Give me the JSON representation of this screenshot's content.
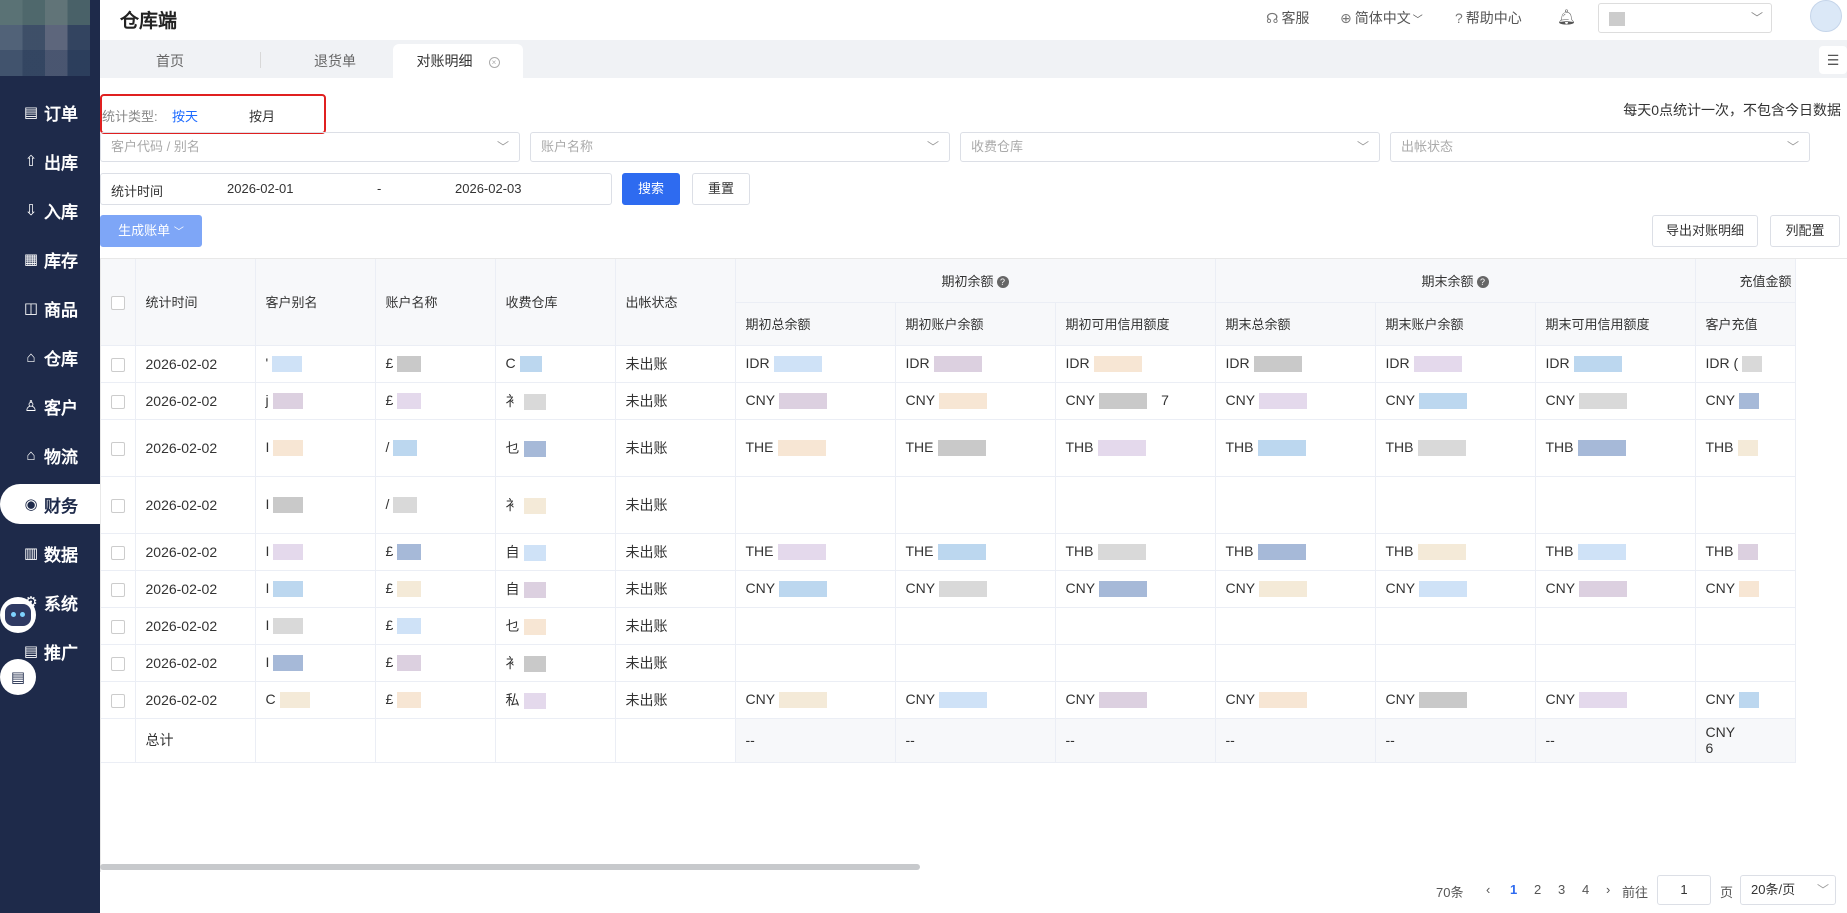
{
  "app_title": "仓库端",
  "header": {
    "service": "客服",
    "language": "简体中文",
    "help": "帮助中心"
  },
  "sidebar": {
    "items": [
      {
        "label": "订单",
        "icon": "order-icon",
        "glyph": "▤"
      },
      {
        "label": "出库",
        "icon": "outbound-icon",
        "glyph": "⇧"
      },
      {
        "label": "入库",
        "icon": "inbound-icon",
        "glyph": "⇩"
      },
      {
        "label": "库存",
        "icon": "inventory-icon",
        "glyph": "▦"
      },
      {
        "label": "商品",
        "icon": "goods-icon",
        "glyph": "◫"
      },
      {
        "label": "仓库",
        "icon": "warehouse-icon",
        "glyph": "⌂"
      },
      {
        "label": "客户",
        "icon": "customer-icon",
        "glyph": "♙"
      },
      {
        "label": "物流",
        "icon": "logistics-icon",
        "glyph": "⌂"
      },
      {
        "label": "财务",
        "icon": "finance-icon",
        "glyph": "◉"
      },
      {
        "label": "数据",
        "icon": "data-icon",
        "glyph": "▥"
      },
      {
        "label": "系统",
        "icon": "system-icon",
        "glyph": "⚙"
      },
      {
        "label": "推广",
        "icon": "promotion-icon",
        "glyph": "▤"
      }
    ],
    "active": "财务"
  },
  "tabs": [
    {
      "label": "首页"
    },
    {
      "label": "退货单"
    },
    {
      "label": "对账明细",
      "close": "⊗"
    }
  ],
  "filters": {
    "stat_type_label": "统计类型:",
    "stat_type_day": "按天",
    "stat_type_month": "按月",
    "notice": "每天0点统计一次，不包含今日数据",
    "customer_placeholder": "客户代码 / 别名",
    "account_placeholder": "账户名称",
    "warehouse_placeholder": "收费仓库",
    "status_placeholder": "出帐状态",
    "date_label": "统计时间",
    "date_start": "2026-02-01",
    "date_sep": "-",
    "date_end": "2026-02-03",
    "search_btn": "搜索",
    "reset_btn": "重置",
    "generate_btn": "生成账单",
    "export_btn": "导出对账明细",
    "columns_btn": "列配置"
  },
  "table": {
    "columns": {
      "stat_time": "统计时间",
      "alias": "客户别名",
      "account": "账户名称",
      "warehouse": "收费仓库",
      "status": "出帐状态",
      "opening_group": "期初余额",
      "closing_group": "期末余额",
      "recharge_group": "充值金额",
      "open_total": "期初总余额",
      "open_account": "期初账户余额",
      "open_credit": "期初可用信用额度",
      "close_total": "期末总余额",
      "close_account": "期末账户余额",
      "close_credit": "期末可用信用额度",
      "recharge": "客户充值"
    },
    "rows": [
      {
        "date": "2026-02-02",
        "alias": "'",
        "account": "£",
        "wh": "C",
        "status": "未出账",
        "c1": "IDR",
        "c2": "IDR",
        "c3": "IDR",
        "c4": "IDR",
        "c5": "IDR",
        "c6": "IDR",
        "c7": "IDR (",
        "extra": ""
      },
      {
        "date": "2026-02-02",
        "alias": "j",
        "account": "£",
        "wh": "衤",
        "status": "未出账",
        "c1": "CNY",
        "c2": "CNY",
        "c3": "CNY",
        "c4": "CNY",
        "c5": "CNY",
        "c6": "CNY",
        "c7": "CNY",
        "extra": "7"
      },
      {
        "date": "2026-02-02",
        "alias": "I",
        "account": "/",
        "wh": "乜",
        "status": "未出账",
        "c1": "THE",
        "c2": "THE",
        "c3": "THB",
        "c4": "THB",
        "c5": "THB",
        "c6": "THB",
        "c7": "THB",
        "extra": ""
      },
      {
        "date": "2026-02-02",
        "alias": "I",
        "account": "/",
        "wh": "衤",
        "status": "未出账",
        "c1": "",
        "c2": "",
        "c3": "",
        "c4": "",
        "c5": "",
        "c6": "",
        "c7": "",
        "extra": ""
      },
      {
        "date": "2026-02-02",
        "alias": "I",
        "account": "£",
        "wh": "自",
        "status": "未出账",
        "c1": "THE",
        "c2": "THE",
        "c3": "THB",
        "c4": "THB",
        "c5": "THB",
        "c6": "THB",
        "c7": "THB",
        "extra": ""
      },
      {
        "date": "2026-02-02",
        "alias": "I",
        "account": "£",
        "wh": "自",
        "status": "未出账",
        "c1": "CNY",
        "c2": "CNY",
        "c3": "CNY",
        "c4": "CNY",
        "c5": "CNY",
        "c6": "CNY",
        "c7": "CNY",
        "extra": ""
      },
      {
        "date": "2026-02-02",
        "alias": "I",
        "account": "£",
        "wh": "乜",
        "status": "未出账",
        "c1": "",
        "c2": "",
        "c3": "",
        "c4": "",
        "c5": "",
        "c6": "",
        "c7": "",
        "extra": ""
      },
      {
        "date": "2026-02-02",
        "alias": "I",
        "account": "£",
        "wh": "衤",
        "status": "未出账",
        "c1": "",
        "c2": "",
        "c3": "",
        "c4": "",
        "c5": "",
        "c6": "",
        "c7": "",
        "extra": ""
      },
      {
        "date": "2026-02-02",
        "alias": "C",
        "account": "£",
        "wh": "私",
        "status": "未出账",
        "c1": "CNY",
        "c2": "CNY",
        "c3": "CNY",
        "c4": "CNY",
        "c5": "CNY",
        "c6": "CNY",
        "c7": "CNY",
        "extra": ""
      }
    ],
    "total": {
      "label": "总计",
      "c1": "--",
      "c2": "--",
      "c3": "--",
      "c4": "--",
      "c5": "--",
      "c6": "--",
      "c7a": "CNY",
      "c7b": "6"
    }
  },
  "pagination": {
    "total": "70条",
    "pages": [
      "1",
      "2",
      "3",
      "4"
    ],
    "current": "1",
    "goto_label": "前往",
    "goto_value": "1",
    "page_unit": "页",
    "page_size": "20条/页"
  }
}
